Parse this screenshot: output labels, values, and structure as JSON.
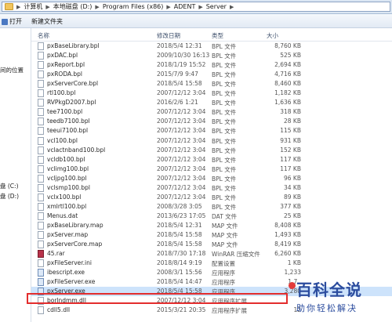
{
  "address_bar": {
    "crumbs": [
      "计算机",
      "本地磁盘 (D:)",
      "Program Files (x86)",
      "ADENT",
      "Server"
    ]
  },
  "toolbar": {
    "open_label": "打开",
    "new_folder_label": "新建文件夹"
  },
  "sidebar": {
    "items": [
      "间的位置",
      "盘 (C:)",
      "盘 (D:)"
    ]
  },
  "columns": {
    "name": "名称",
    "date": "修改日期",
    "type": "类型",
    "size": "大小"
  },
  "files": [
    {
      "name": "pxBaseLibrary.bpl",
      "date": "2018/5/4 12:31",
      "type": "BPL 文件",
      "size": "8,760 KB",
      "icon": "file-icon"
    },
    {
      "name": "pxDAC.bpl",
      "date": "2009/10/30 16:13",
      "type": "BPL 文件",
      "size": "525 KB",
      "icon": "file-icon"
    },
    {
      "name": "pxReport.bpl",
      "date": "2018/1/19 15:52",
      "type": "BPL 文件",
      "size": "2,694 KB",
      "icon": "file-icon"
    },
    {
      "name": "pxRODA.bpl",
      "date": "2015/7/9 9:47",
      "type": "BPL 文件",
      "size": "4,716 KB",
      "icon": "file-icon"
    },
    {
      "name": "pxServerCore.bpl",
      "date": "2018/5/4 15:58",
      "type": "BPL 文件",
      "size": "8,460 KB",
      "icon": "file-icon"
    },
    {
      "name": "rtl100.bpl",
      "date": "2007/12/12 3:04",
      "type": "BPL 文件",
      "size": "1,182 KB",
      "icon": "file-icon"
    },
    {
      "name": "RVPkgD2007.bpl",
      "date": "2016/2/6 1:21",
      "type": "BPL 文件",
      "size": "1,636 KB",
      "icon": "file-icon"
    },
    {
      "name": "tee7100.bpl",
      "date": "2007/12/12 3:04",
      "type": "BPL 文件",
      "size": "318 KB",
      "icon": "file-icon"
    },
    {
      "name": "teedb7100.bpl",
      "date": "2007/12/12 3:04",
      "type": "BPL 文件",
      "size": "28 KB",
      "icon": "file-icon"
    },
    {
      "name": "teeui7100.bpl",
      "date": "2007/12/12 3:04",
      "type": "BPL 文件",
      "size": "115 KB",
      "icon": "file-icon"
    },
    {
      "name": "vcl100.bpl",
      "date": "2007/12/12 3:04",
      "type": "BPL 文件",
      "size": "931 KB",
      "icon": "file-icon"
    },
    {
      "name": "vclactnband100.bpl",
      "date": "2007/12/12 3:04",
      "type": "BPL 文件",
      "size": "152 KB",
      "icon": "file-icon"
    },
    {
      "name": "vcldb100.bpl",
      "date": "2007/12/12 3:04",
      "type": "BPL 文件",
      "size": "117 KB",
      "icon": "file-icon"
    },
    {
      "name": "vclimg100.bpl",
      "date": "2007/12/12 3:04",
      "type": "BPL 文件",
      "size": "117 KB",
      "icon": "file-icon"
    },
    {
      "name": "vcljpg100.bpl",
      "date": "2007/12/12 3:04",
      "type": "BPL 文件",
      "size": "96 KB",
      "icon": "file-icon"
    },
    {
      "name": "vclsmp100.bpl",
      "date": "2007/12/12 3:04",
      "type": "BPL 文件",
      "size": "34 KB",
      "icon": "file-icon"
    },
    {
      "name": "vclx100.bpl",
      "date": "2007/12/12 3:04",
      "type": "BPL 文件",
      "size": "89 KB",
      "icon": "file-icon"
    },
    {
      "name": "xmlrtl100.bpl",
      "date": "2008/3/28 3:05",
      "type": "BPL 文件",
      "size": "377 KB",
      "icon": "file-icon"
    },
    {
      "name": "Menus.dat",
      "date": "2013/6/23 17:05",
      "type": "DAT 文件",
      "size": "25 KB",
      "icon": "file-icon"
    },
    {
      "name": "pxBaseLibrary.map",
      "date": "2018/5/4 12:31",
      "type": "MAP 文件",
      "size": "8,408 KB",
      "icon": "file-icon"
    },
    {
      "name": "pxServer.map",
      "date": "2018/5/4 15:58",
      "type": "MAP 文件",
      "size": "1,493 KB",
      "icon": "file-icon"
    },
    {
      "name": "pxServerCore.map",
      "date": "2018/5/4 15:58",
      "type": "MAP 文件",
      "size": "8,419 KB",
      "icon": "file-icon"
    },
    {
      "name": "45.rar",
      "date": "2018/7/30 17:18",
      "type": "WinRAR 压缩文件",
      "size": "6,260 KB",
      "icon": "rar-icon"
    },
    {
      "name": "pxFileServer.ini",
      "date": "2018/8/14 9:19",
      "type": "配置设置",
      "size": "1 KB",
      "icon": "settings-file-icon"
    },
    {
      "name": "ibescript.exe",
      "date": "2008/3/1 15:56",
      "type": "应用程序",
      "size": "1,233",
      "icon": "exe-icon"
    },
    {
      "name": "pxFileServer.exe",
      "date": "2018/5/4 14:47",
      "type": "应用程序",
      "size": "1,7..",
      "icon": "exe-icon"
    },
    {
      "name": "pxServer.exe",
      "date": "2018/5/4 15:58",
      "type": "应用程序",
      "size": "3,280",
      "icon": "exe-icon"
    },
    {
      "name": "borlndmm.dll",
      "date": "2007/12/12 3:04",
      "type": "应用程序扩展",
      "size": "",
      "icon": "dll-icon"
    },
    {
      "name": "cdll5.dll",
      "date": "2015/3/21 20:35",
      "type": "应用程序扩展",
      "size": "12",
      "icon": "dll-icon"
    }
  ],
  "watermark": {
    "title": "百科全说",
    "subtitle": "助你轻松解决"
  },
  "colors": {
    "highlight_border": "#e32d2d",
    "watermark": "#2b4c9e"
  }
}
